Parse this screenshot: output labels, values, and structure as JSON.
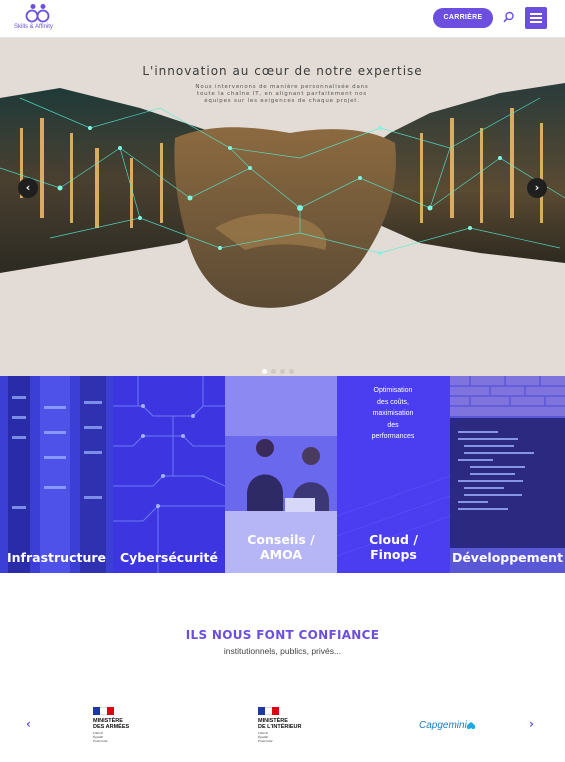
{
  "header": {
    "logo_text": "Skills & Affinity",
    "career_label": "CARRIÈRE",
    "search_icon": "search-icon",
    "menu_icon": "hamburger-menu-icon"
  },
  "hero": {
    "title": "L'innovation au cœur de notre expertise",
    "subtitle_lines": [
      "Nous intervenons de manière personnalisée dans",
      "toute la chaîne IT, en alignant parfaitement nos",
      "équipes sur les exigences de chaque projet."
    ],
    "prev_arrow": "‹",
    "next_arrow": "›",
    "slide_count": 4,
    "active_slide": 1
  },
  "services": [
    {
      "label": "Infrastructure",
      "desc_lines": []
    },
    {
      "label": "Cybersécurité",
      "desc_lines": []
    },
    {
      "label_lines": [
        "Conseils /",
        "AMOA"
      ],
      "desc_lines": []
    },
    {
      "label_lines": [
        "Cloud /",
        "Finops"
      ],
      "desc_lines": [
        "Optimisation",
        "des coûts,",
        "maximisation",
        "des",
        "performances"
      ]
    },
    {
      "label": "Développement",
      "desc_lines": []
    }
  ],
  "trust": {
    "title": "ILS NOUS FONT CONFIANCE",
    "subtitle": "institutionnels, publics, privés...",
    "prev_arrow": "‹",
    "next_arrow": "›",
    "partners": [
      {
        "name_lines": [
          "MINISTÈRE",
          "DES ARMÉES"
        ],
        "motto_lines": [
          "Liberté",
          "Égalité",
          "Fraternité"
        ]
      },
      {
        "name_lines": [
          "MINISTÈRE",
          "DE L'INTÉRIEUR"
        ],
        "motto_lines": [
          "Liberté",
          "Égalité",
          "Fraternité"
        ]
      },
      {
        "name": "Capgemini"
      }
    ]
  },
  "colors": {
    "brand_purple": "#6c4fdf",
    "hero_background": "#e3dcd6",
    "tile_overlay": "#4b3ef0"
  }
}
